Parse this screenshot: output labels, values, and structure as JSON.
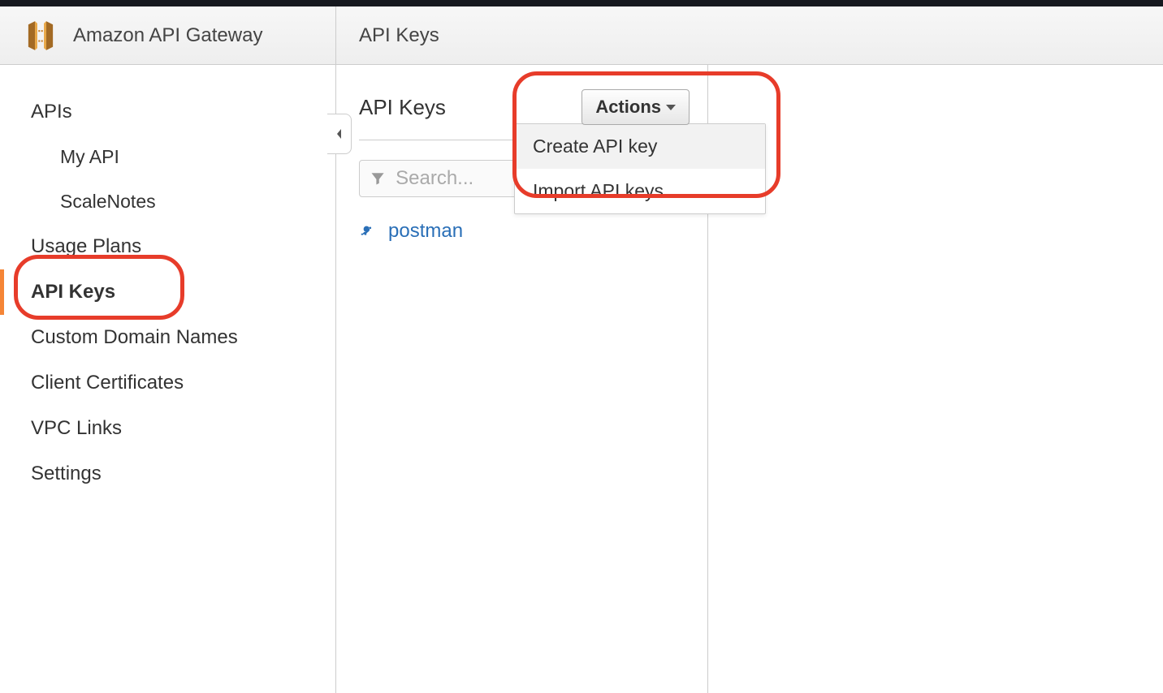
{
  "header": {
    "service_name": "Amazon API Gateway",
    "breadcrumb": "API Keys"
  },
  "sidebar": {
    "items": [
      {
        "label": "APIs",
        "type": "item"
      },
      {
        "label": "My API",
        "type": "subitem"
      },
      {
        "label": "ScaleNotes",
        "type": "subitem"
      },
      {
        "label": "Usage Plans",
        "type": "item"
      },
      {
        "label": "API Keys",
        "type": "item",
        "active": true
      },
      {
        "label": "Custom Domain Names",
        "type": "item"
      },
      {
        "label": "Client Certificates",
        "type": "item"
      },
      {
        "label": "VPC Links",
        "type": "item"
      },
      {
        "label": "Settings",
        "type": "item"
      }
    ]
  },
  "content": {
    "title": "API Keys",
    "actions_label": "Actions",
    "search_placeholder": "Search...",
    "keys": [
      {
        "name": "postman"
      }
    ],
    "dropdown": {
      "items": [
        {
          "label": "Create API key",
          "hovered": true
        },
        {
          "label": "Import API keys",
          "hovered": false
        }
      ]
    }
  }
}
